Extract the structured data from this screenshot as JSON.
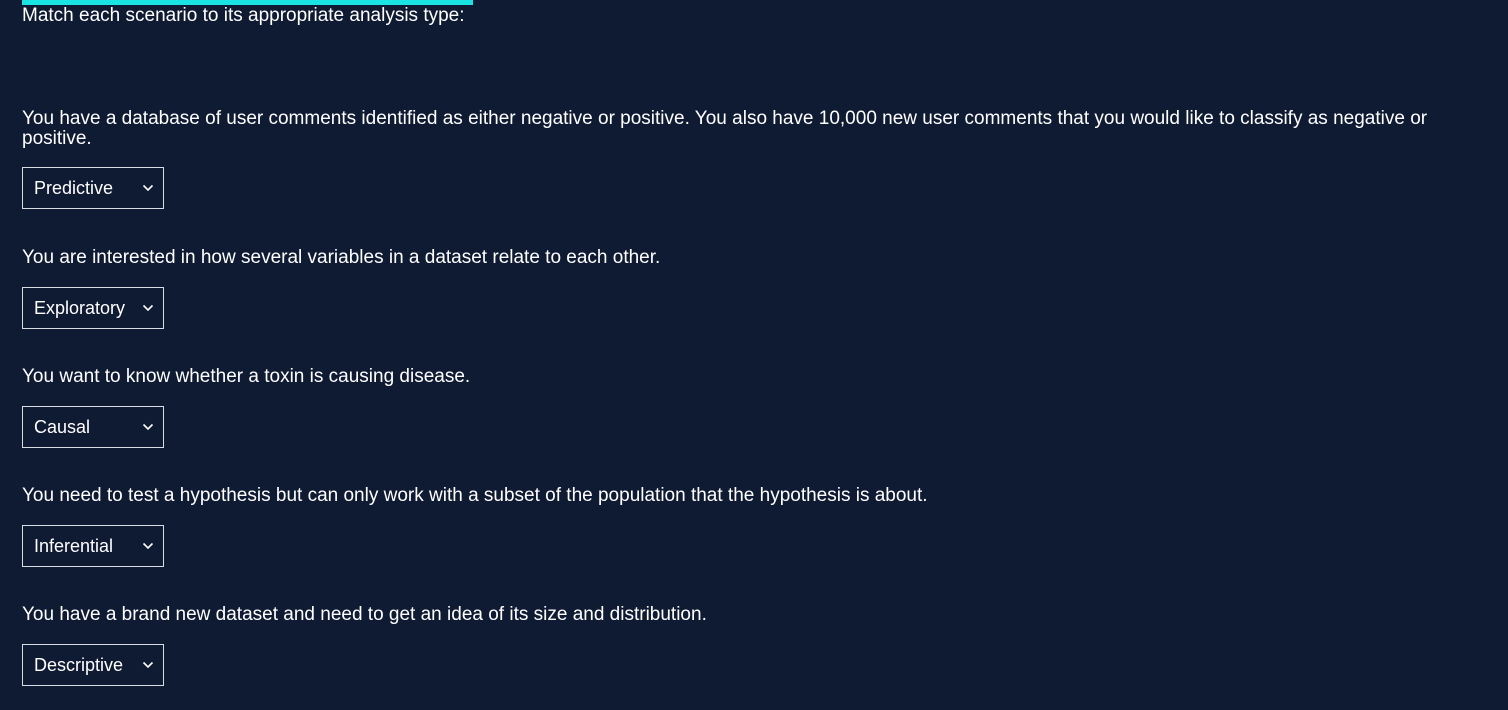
{
  "prompt": "Match each scenario to its appropriate analysis type:",
  "questions": [
    {
      "text": "You have a database of user comments identified as either negative or positive. You also have 10,000 new user comments that you would like to classify as negative or positive.",
      "selected": "Predictive"
    },
    {
      "text": "You are interested in how several variables in a dataset relate to each other.",
      "selected": "Exploratory"
    },
    {
      "text": "You want to know whether a toxin is causing disease.",
      "selected": "Causal"
    },
    {
      "text": "You need to test a hypothesis but can only work with a subset of the population that the hypothesis is about.",
      "selected": "Inferential"
    },
    {
      "text": "You have a brand new dataset and need to get an idea of its size and distribution.",
      "selected": "Descriptive"
    }
  ],
  "colors": {
    "background": "#0f1a33",
    "accent": "#19e3e3",
    "text": "#ffffff"
  },
  "icons": {
    "dropdown": "chevron-down-icon"
  }
}
